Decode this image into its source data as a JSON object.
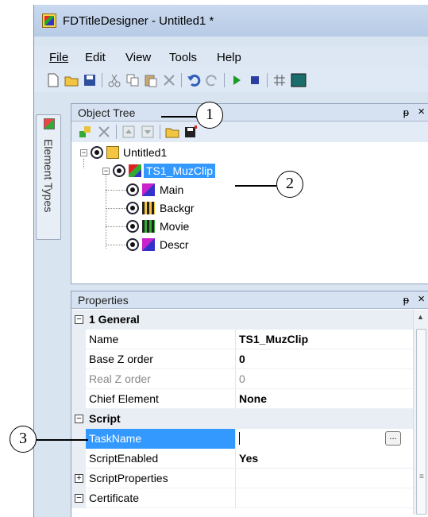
{
  "window": {
    "title": "FDTitleDesigner - Untitled1 *"
  },
  "menu": [
    "File",
    "Edit",
    "View",
    "Tools",
    "Help"
  ],
  "side_tab": {
    "label": "Element Types"
  },
  "object_tree": {
    "title": "Object Tree",
    "pin": "ᵽ",
    "close": "×",
    "root": "Untitled1",
    "selected": "TS1_MuzClip",
    "children": [
      "Main",
      "Backgr",
      "Movie",
      "Descr"
    ]
  },
  "properties": {
    "title": "Properties",
    "pin": "ᵽ",
    "close": "×",
    "rows": [
      {
        "type": "category",
        "expander": "⊟",
        "name": "1 General"
      },
      {
        "type": "prop",
        "name": "Name",
        "value": "TS1_MuzClip"
      },
      {
        "type": "prop",
        "name": "Base Z order",
        "value": "0"
      },
      {
        "type": "prop",
        "name": "Real Z order",
        "value": "0"
      },
      {
        "type": "prop",
        "name": "Chief Element",
        "value": "None"
      },
      {
        "type": "category",
        "expander": "⊟",
        "name": "Script"
      },
      {
        "type": "prop",
        "name": "TaskName",
        "value": "",
        "selected": true
      },
      {
        "type": "prop",
        "name": "ScriptEnabled",
        "value": "Yes"
      },
      {
        "type": "expandable",
        "expander": "⊞",
        "name": "ScriptProperties",
        "value": ""
      },
      {
        "type": "expandable",
        "expander": "⊟",
        "name": "Certificate",
        "value": ""
      }
    ],
    "ellipsis": "..."
  },
  "callouts": [
    "1",
    "2",
    "3"
  ],
  "colors": {
    "selection": "#3399ff",
    "window_bg": "#d9e4f1",
    "panel_header": "#d6e2f1"
  }
}
